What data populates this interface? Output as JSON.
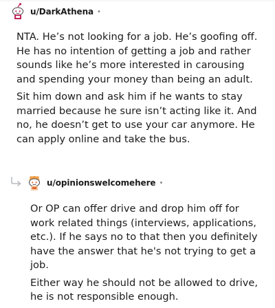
{
  "comments": [
    {
      "username": "u/DarkAthena",
      "separator": "•",
      "avatar": "reddit-snoo-avatar",
      "paragraphs": [
        "NTA. He’s not looking for a job. He’s goofing off. He has no intention of getting a job and rather sounds like he’s more interested in carousing and spending your money than being an adult.",
        "Sit him down and ask him if he wants to stay married because he sure isn’t acting like it. And no, he doesn’t get to use your car anymore. He can apply online and take the bus."
      ]
    },
    {
      "username": "u/opinionswelcomehere",
      "separator": "•",
      "avatar": "reddit-snoo-avatar",
      "reply_icon": "reply-arrow-icon",
      "paragraphs": [
        "Or OP can offer drive and drop him off for work related things (interviews, applications, etc.). If he says no to that then you definitely have the answer that he's not trying to get a job.",
        "Either way he should not be allowed to drive, he is not responsible enough."
      ]
    }
  ],
  "colors": {
    "text": "#1c1c1c",
    "meta": "#7c7c7c",
    "avatar1_accent": "#c0245a",
    "avatar2_accent": "#f0a04b"
  }
}
